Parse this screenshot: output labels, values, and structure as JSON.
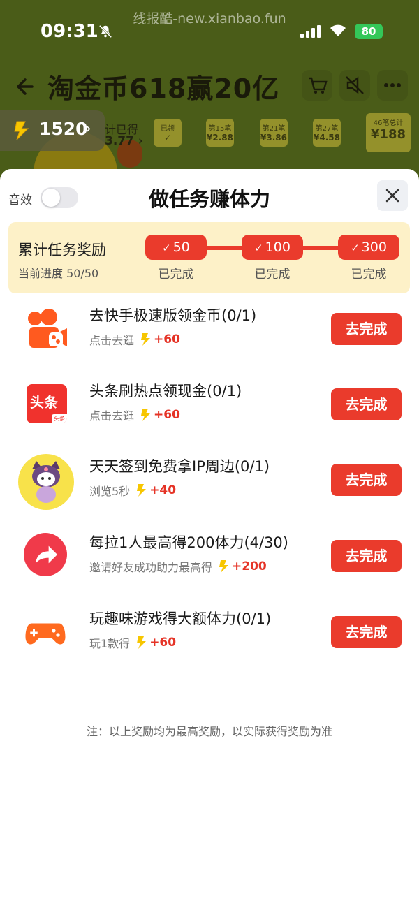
{
  "watermark": "线报酷-new.xianbao.fun",
  "status_bar": {
    "time": "09:31",
    "battery": "80"
  },
  "header": {
    "title": "淘金币618赢20亿"
  },
  "coins": {
    "balance": "1520",
    "chevron": "›"
  },
  "background": {
    "accum_label": "计已得",
    "accum_value": "3.77 ›",
    "steps": [
      {
        "top": "已领",
        "bottom": "✓"
      },
      {
        "top": "第15笔",
        "bottom": "¥2.88"
      },
      {
        "top": "第21笔",
        "bottom": "¥3.86"
      },
      {
        "top": "第27笔",
        "bottom": "¥4.58"
      },
      {
        "top": "46笔总计",
        "bottom": "¥188"
      }
    ]
  },
  "sheet": {
    "sound_label": "音效",
    "title": "做任务赚体力",
    "progress": {
      "title": "累计任务奖励",
      "current": "当前进度 50/50",
      "milestones": [
        {
          "value": "50",
          "status": "已完成"
        },
        {
          "value": "100",
          "status": "已完成"
        },
        {
          "value": "300",
          "status": "已完成"
        }
      ]
    },
    "tasks": [
      {
        "title": "去快手极速版领金币(0/1)",
        "sub": "点击去逛",
        "reward": "+60",
        "button": "去完成",
        "icon": "kuaishou-icon"
      },
      {
        "title": "头条刷热点领现金(0/1)",
        "sub": "点击去逛",
        "reward": "+60",
        "button": "去完成",
        "icon": "toutiao-icon",
        "icon_text": "头条",
        "icon_subtext": "头条"
      },
      {
        "title": "天天签到免费拿IP周边(0/1)",
        "sub": "浏览5秒",
        "reward": "+40",
        "button": "去完成",
        "icon": "kuromi-plush-icon"
      },
      {
        "title": "每拉1人最高得200体力(4/30)",
        "sub": "邀请好友成功助力最高得",
        "reward": "+200",
        "button": "去完成",
        "icon": "share-arrow-icon"
      },
      {
        "title": "玩趣味游戏得大额体力(0/1)",
        "sub": "玩1款得",
        "reward": "+60",
        "button": "去完成",
        "icon": "gamepad-icon"
      }
    ],
    "note": "注：以上奖励均为最高奖励，以实际获得奖励为准"
  },
  "colors": {
    "accent": "#ea3b2c",
    "progress_bg": "#fdf1c8",
    "battery": "#34c759"
  }
}
